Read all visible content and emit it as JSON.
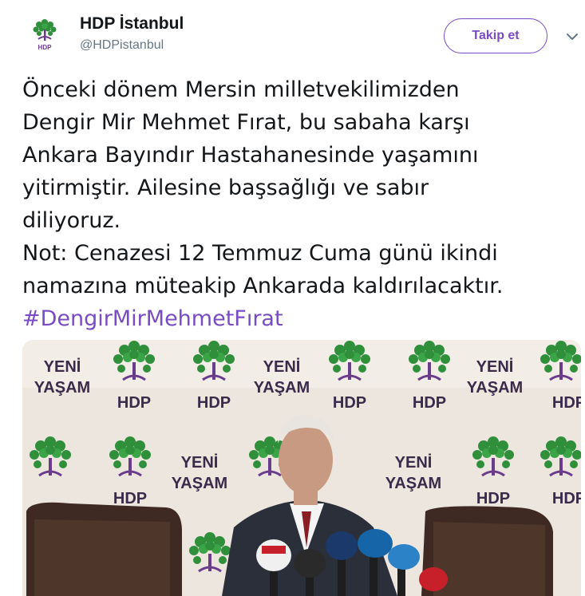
{
  "tweet": {
    "author": {
      "name": "HDP İstanbul",
      "handle": "@HDPistanbul",
      "avatar_label": "HDP"
    },
    "follow_label": "Takip et",
    "text_lines": [
      "Önceki dönem Mersin milletvekilimizden",
      "Dengir Mir Mehmet Fırat, bu sabaha karşı",
      "Ankara Bayındır Hastahanesinde yaşamını",
      "yitirmiştir. Ailesine başsağlığı ve sabır",
      "diliyoruz.",
      "Not: Cenazesi 12 Temmuz Cuma günü ikindi",
      "namazına müteakip Ankarada kaldırılacaktır."
    ],
    "hashtag": "#DengirMirMehmetFırat"
  },
  "media": {
    "backdrop_slogan_line1": "YENİ",
    "backdrop_slogan_line2": "YAŞAM",
    "backdrop_logo": "HDP"
  },
  "colors": {
    "accent": "#794bc4",
    "text": "#14171a",
    "secondary": "#657786"
  },
  "icons": {
    "caret": "chevron-down-icon"
  }
}
